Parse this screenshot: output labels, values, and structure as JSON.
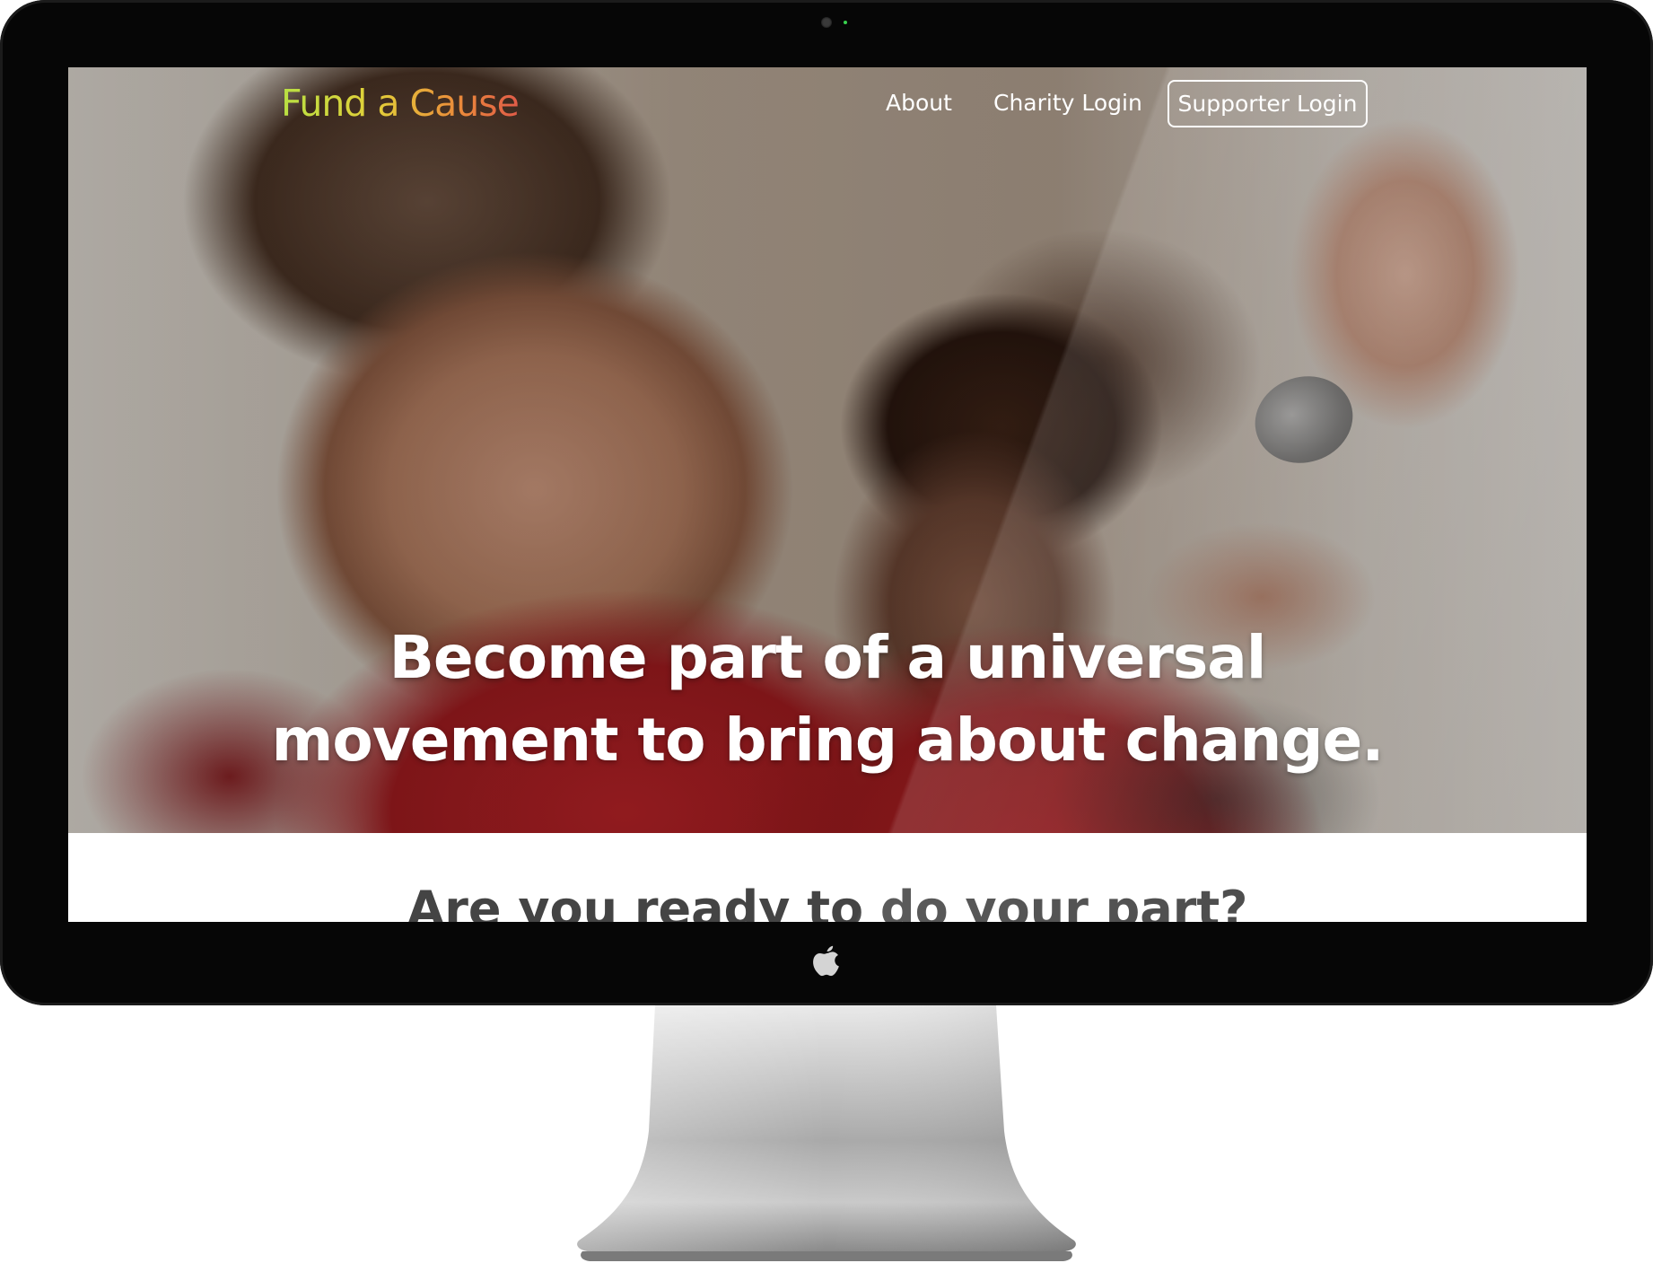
{
  "navbar": {
    "brand": "Fund a Cause",
    "links": [
      {
        "label": "About"
      },
      {
        "label": "Charity Login"
      }
    ],
    "cta_label": "Supporter Login"
  },
  "hero": {
    "headline_line1": "Become part of a universal",
    "headline_line2": "movement to bring about change."
  },
  "section": {
    "heading": "Are you ready to do your part?"
  },
  "colors": {
    "bezel": "#060606",
    "brand_gradient": [
      "#b8e043",
      "#e3cf39",
      "#eb8a3a",
      "#e05b48"
    ],
    "nav_text": "#ffffff",
    "heading_text": "#444444"
  },
  "icons": {
    "device_logo": "apple-icon",
    "camera": "camera-icon"
  }
}
